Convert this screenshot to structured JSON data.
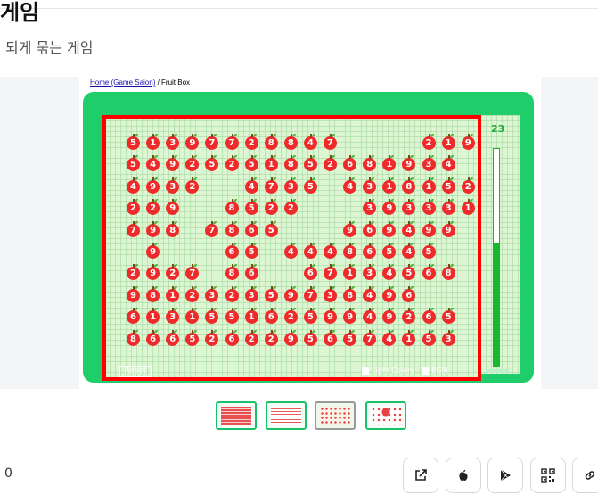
{
  "page": {
    "title": "게임",
    "subtitle": "되게 묶는 게임"
  },
  "breadcrumb": {
    "link": "Home (Game Saion)",
    "separator": " / ",
    "current": "Fruit Box"
  },
  "game": {
    "score": "23",
    "timer_fraction": 0.57,
    "reset_label": "Reset",
    "light_colors_label": "Light Colors",
    "bgm_label": "BGM",
    "grid": [
      "5139772884700002191",
      "5492525185268193400",
      "4932004735043181520",
      "2290085220003933318",
      "7980786500096949900",
      "0900065044486545000",
      "2927086006713456800",
      "9812323597384960000",
      "6131551625994926500",
      "8665262295657415300"
    ]
  },
  "bottom": {
    "count": "0"
  },
  "thumbnails": [
    "screenshot-1",
    "screenshot-2",
    "screenshot-3",
    "screenshot-4"
  ],
  "colors": {
    "frame": "#1fce6a",
    "board": "#ddf6d2",
    "apple": "#ee2a2a",
    "selection": "#ff0000"
  }
}
